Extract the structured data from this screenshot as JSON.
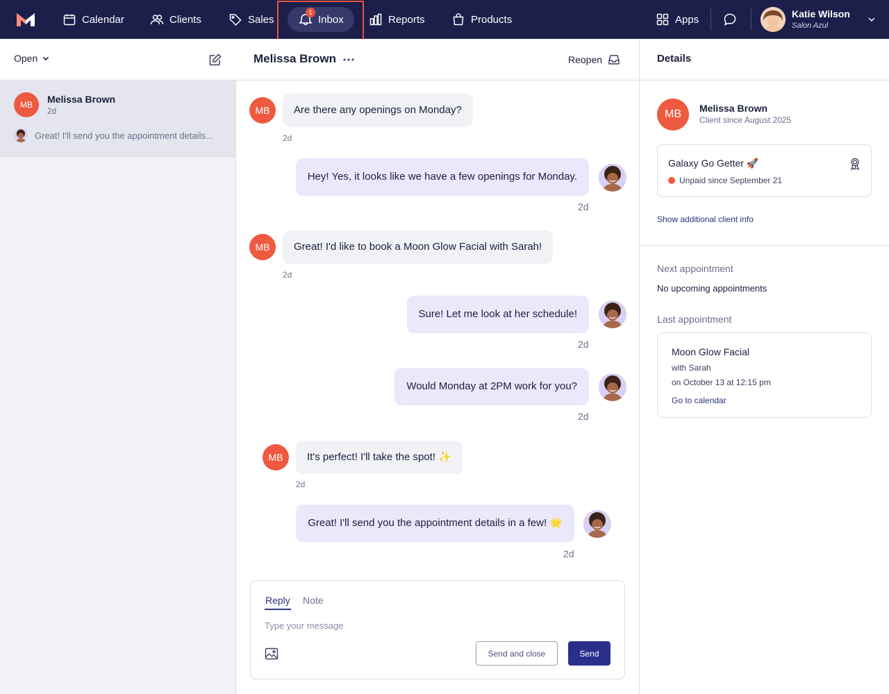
{
  "nav": {
    "items": [
      {
        "label": "Calendar",
        "icon": "calendar-icon"
      },
      {
        "label": "Clients",
        "icon": "clients-icon"
      },
      {
        "label": "Sales",
        "icon": "tag-icon"
      },
      {
        "label": "Inbox",
        "icon": "inbox-icon",
        "active": true,
        "badge": "1"
      },
      {
        "label": "Reports",
        "icon": "bar-chart-icon"
      },
      {
        "label": "Products",
        "icon": "shopping-bag-icon"
      }
    ],
    "apps_label": "Apps",
    "user": {
      "name": "Katie Wilson",
      "salon": "Salon Azul"
    },
    "colors": {
      "nav_bg": "#1b1f4a",
      "highlight": "#e5533c"
    }
  },
  "left": {
    "filter_label": "Open",
    "conversation": {
      "initials": "MB",
      "name": "Melissa Brown",
      "time": "2d",
      "preview": "Great! I'll send you the appointment details..."
    }
  },
  "chat": {
    "contact_name": "Melissa Brown",
    "more_icon": "ellipsis-icon",
    "reopen_label": "Reopen",
    "messages": [
      {
        "direction": "in",
        "initials": "MB",
        "text": "Are there any openings on Monday?",
        "time": "2d"
      },
      {
        "direction": "out",
        "text": "Hey! Yes, it looks like we have a few openings for Monday.",
        "time": "2d"
      },
      {
        "direction": "in",
        "initials": "MB",
        "text": "Great! I'd like to book a Moon Glow Facial with Sarah!",
        "time": "2d"
      },
      {
        "direction": "out",
        "text": "Sure! Let me look at her schedule!",
        "time": "2d"
      },
      {
        "direction": "out",
        "text": "Would Monday at 2PM work for you?",
        "time": "2d"
      },
      {
        "direction": "in",
        "initials": "MB",
        "text": "It's perfect! I'll take the spot! ✨",
        "time": "2d"
      },
      {
        "direction": "out",
        "text": "Great! I'll send you the appointment details in a few! 🌟",
        "time": "2d"
      }
    ],
    "composer": {
      "tab_reply": "Reply",
      "tab_note": "Note",
      "placeholder": "Type your message",
      "send_close_label": "Send and close",
      "send_label": "Send"
    }
  },
  "details": {
    "title": "Details",
    "client": {
      "initials": "MB",
      "name": "Melissa Brown",
      "since": "Client since August 2025"
    },
    "membership": {
      "name": "Galaxy Go Getter 🚀",
      "status": "Unpaid since September 21",
      "status_color": "#ee5a40"
    },
    "show_more_label": "Show additional client info",
    "next_appt_label": "Next appointment",
    "next_appt_value": "No upcoming appointments",
    "last_appt_label": "Last appointment",
    "last_appt": {
      "service": "Moon Glow Facial",
      "with": "with Sarah",
      "when": "on October 13 at 12:15 pm",
      "link": "Go to calendar"
    }
  }
}
